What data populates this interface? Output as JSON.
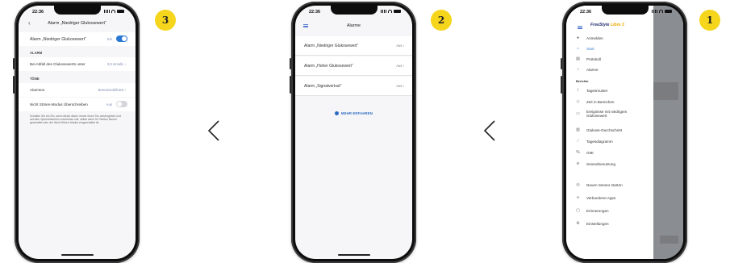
{
  "steps": {
    "left": "3",
    "middle": "2",
    "right": "1"
  },
  "status_time": "22:36",
  "screen3": {
    "title": "Alarm „Niedriger Glukosewert“",
    "main_toggle_label": "Alarm „Niedriger Glukosewert“",
    "main_toggle_value": "Ein",
    "section_alarm": "ALARM",
    "threshold_label": "Bei Abfall des Glukosewerts unter",
    "threshold_value": "3,9 mmol/L",
    "section_tones": "TÖNE",
    "alarm_tone_label": "Alarmton",
    "alarm_tone_value": "Benutzerdefiniert",
    "dnd_label": "Nicht Stören-Modus Überschreiben",
    "dnd_value": "Aus",
    "dnd_hint": "Schalten Sie ein Ein, wenn dieser Alarm immer einen Ton wiedergeben und auf dem Sperrbildschirm erscheinen soll, selbst wenn Ihr Telefon stumm geschaltet oder der Nicht-Stören-Modus eingeschaltet ist."
  },
  "screen2": {
    "title": "Alarme",
    "alarms": [
      {
        "label": "Alarm „Niedriger Glukosewert“",
        "value": "Aus"
      },
      {
        "label": "Alarm „Hoher Glukosewert“",
        "value": "Aus"
      },
      {
        "label": "Alarm „Signalverlust“",
        "value": "Aus"
      }
    ],
    "more_label": "MEHR ERFAHREN"
  },
  "screen1": {
    "brand_main": "FreeStyle ",
    "brand_accent": "Libre 3",
    "items_top": [
      "Anmelden",
      "Start",
      "Protokoll",
      "Alarme"
    ],
    "section_reports": "Berichte",
    "reports": [
      "Tagesmuster",
      "Zeit in Bereichen",
      "Ereignisse mit niedrigem Glukosewert",
      "Glukose-Durchschnitt",
      "Tagesdiagramm",
      "GMI",
      "Sensorbenutzung"
    ],
    "items_bottom": [
      "Neuen Sensor starten",
      "Verbundene Apps",
      "Erinnerungen",
      "Einstellungen"
    ]
  },
  "colors": {
    "badge": "#f6d61c",
    "accent_blue": "#2b78d4",
    "brand_navy": "#1f2f6e",
    "brand_yellow": "#f2a900"
  },
  "icons": [
    "chevron-left-icon",
    "hamburger-menu-icon",
    "toggle-switch-icon",
    "chevron-right-icon"
  ]
}
